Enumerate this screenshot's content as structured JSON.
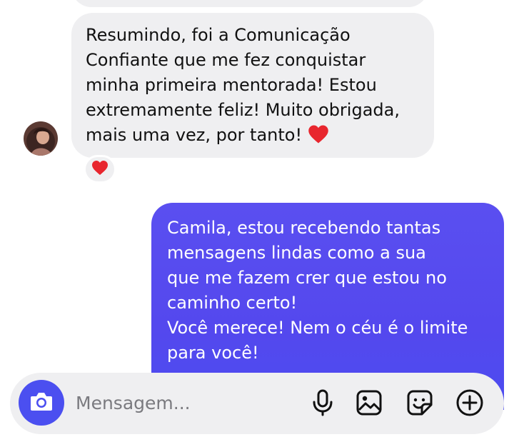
{
  "conversation": {
    "incoming": {
      "text": "Resumindo, foi a Comunicação\nConfiante que me fez conquistar\nminha primeira mentorada! Estou\nextremamente feliz! Muito obrigada,\nmais uma vez, por tanto!",
      "emoji": "heart",
      "reaction": "heart"
    },
    "outgoing": {
      "text": "Camila, estou recebendo tantas\nmensagens lindas como a sua\nque me fazem crer que estou no\ncaminho certo!\nVocê merece! Nem o céu é o limite\npara você!"
    }
  },
  "composer": {
    "placeholder": "Mensagem...",
    "icons": [
      "camera-icon",
      "microphone-icon",
      "image-icon",
      "sticker-icon",
      "plus-icon"
    ]
  },
  "colors": {
    "accent": "#4b4ff0",
    "bubble_incoming": "#efeff1",
    "heart": "#e8262e"
  }
}
